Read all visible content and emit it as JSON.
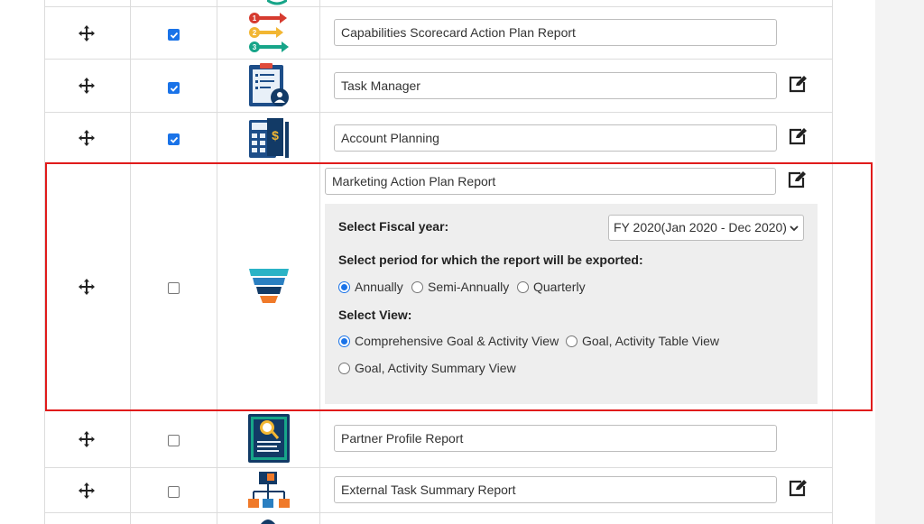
{
  "rows": [
    {
      "name": "Capabilities Scorecard Action Plan Report",
      "checked": true,
      "icon": "numbered-steps-icon",
      "editable": false
    },
    {
      "name": "Task Manager",
      "checked": true,
      "icon": "task-clipboard-icon",
      "editable": true
    },
    {
      "name": "Account Planning",
      "checked": true,
      "icon": "calculator-icon",
      "editable": true
    },
    {
      "name": "Marketing Action Plan Report",
      "checked": false,
      "icon": "funnel-icon",
      "editable": true
    },
    {
      "name": "Partner Profile Report",
      "checked": false,
      "icon": "profile-search-icon",
      "editable": false
    },
    {
      "name": "External Task Summary Report",
      "checked": false,
      "icon": "org-chart-icon",
      "editable": true
    }
  ],
  "expanded": {
    "fiscal_label": "Select Fiscal year:",
    "fiscal_value": "FY 2020(Jan 2020 - Dec 2020)",
    "period_label": "Select period for which the report will be exported:",
    "periods": [
      {
        "label": "Annually",
        "selected": true
      },
      {
        "label": "Semi-Annually",
        "selected": false
      },
      {
        "label": "Quarterly",
        "selected": false
      }
    ],
    "view_label": "Select View:",
    "views": [
      {
        "label": "Comprehensive Goal & Activity View",
        "selected": true
      },
      {
        "label": "Goal, Activity Table View",
        "selected": false
      },
      {
        "label": "Goal, Activity Summary View",
        "selected": false
      }
    ]
  },
  "colors": {
    "accent": "#1a73e8",
    "highlight": "#e01b1b",
    "options_bg": "#eeeeee"
  }
}
